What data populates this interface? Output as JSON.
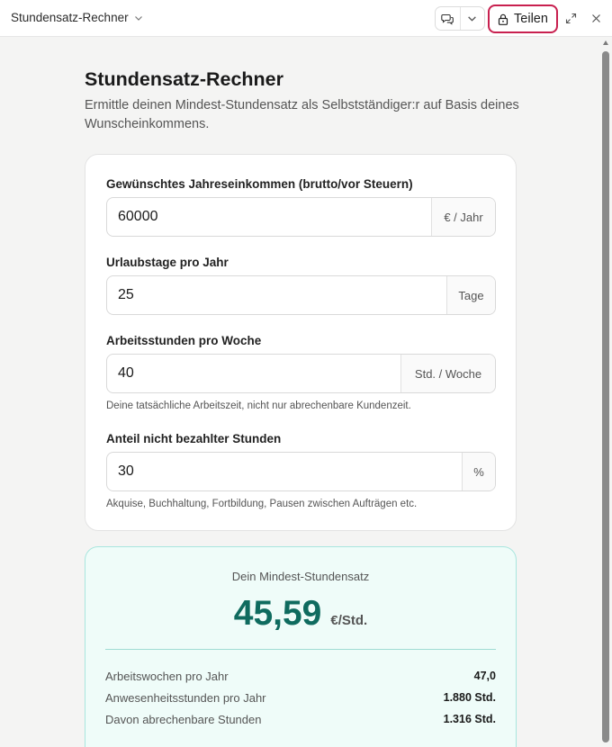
{
  "window": {
    "title": "Stundensatz-Rechner",
    "share_label": "Teilen"
  },
  "page": {
    "title": "Stundensatz-Rechner",
    "subtitle": "Ermittle deinen Mindest-Stundensatz als Selbstständiger:r auf Basis deines Wunscheinkommens."
  },
  "form": {
    "income": {
      "label": "Gewünschtes Jahreseinkommen (brutto/vor Steuern)",
      "value": "60000",
      "unit": "€ / Jahr"
    },
    "vacation": {
      "label": "Urlaubstage pro Jahr",
      "value": "25",
      "unit": "Tage"
    },
    "hours": {
      "label": "Arbeitsstunden pro Woche",
      "value": "40",
      "unit": "Std. / Woche",
      "hint": "Deine tatsächliche Arbeitszeit, nicht nur abrechenbare Kundenzeit."
    },
    "unpaid": {
      "label": "Anteil nicht bezahlter Stunden",
      "value": "30",
      "unit": "%",
      "hint": "Akquise, Buchhaltung, Fortbildung, Pausen zwischen Aufträgen etc."
    }
  },
  "result": {
    "label": "Dein Mindest-Stundensatz",
    "value": "45,59",
    "unit": "€/Std.",
    "stats": [
      {
        "label": "Arbeitswochen pro Jahr",
        "value": "47,0"
      },
      {
        "label": "Anwesenheitsstunden pro Jahr",
        "value": "1.880 Std."
      },
      {
        "label": "Davon abrechenbare Stunden",
        "value": "1.316 Std."
      }
    ]
  },
  "colors": {
    "share_outline": "#c8204f",
    "result_value": "#0f6b5f",
    "result_background": "#effcf9",
    "result_border": "#a8e6de"
  },
  "icons": {
    "title_dropdown": "chevron-down-icon",
    "chat": "chat-bubbles-icon",
    "chat_dropdown": "chevron-down-icon",
    "share": "lock-icon",
    "expand": "expand-icon",
    "close": "close-icon"
  }
}
